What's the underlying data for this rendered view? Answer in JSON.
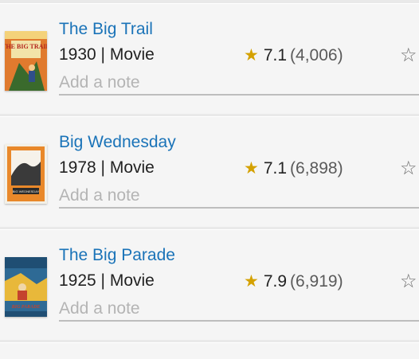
{
  "items": [
    {
      "title": "The Big Trail",
      "meta": "1930 | Movie",
      "rating": "7.1",
      "votes": "(4,006)",
      "note_placeholder": "Add a note",
      "poster_text": "THE BIG TRAIL",
      "poster_colors": [
        "#d8692a",
        "#f0c86a",
        "#3a6a2c"
      ]
    },
    {
      "title": "Big Wednesday",
      "meta": "1978 | Movie",
      "rating": "7.1",
      "votes": "(6,898)",
      "note_placeholder": "Add a note",
      "poster_text": "BIG WEDNESDAY",
      "poster_colors": [
        "#e9882a",
        "#2a2a2a",
        "#f3f0e6"
      ]
    },
    {
      "title": "The Big Parade",
      "meta": "1925 | Movie",
      "rating": "7.9",
      "votes": "(6,919)",
      "note_placeholder": "Add a note",
      "poster_text": "BIG PARADE",
      "poster_colors": [
        "#2e6a95",
        "#e8b83a",
        "#c4432e"
      ]
    }
  ],
  "icons": {
    "rating_star": "filled-star-icon",
    "rate_star": "outline-star-icon"
  },
  "colors": {
    "title_link": "#1a73b8",
    "star_gold": "#d4a100",
    "card_bg": "#f5f5f5",
    "page_bg": "#e9e9e9"
  }
}
